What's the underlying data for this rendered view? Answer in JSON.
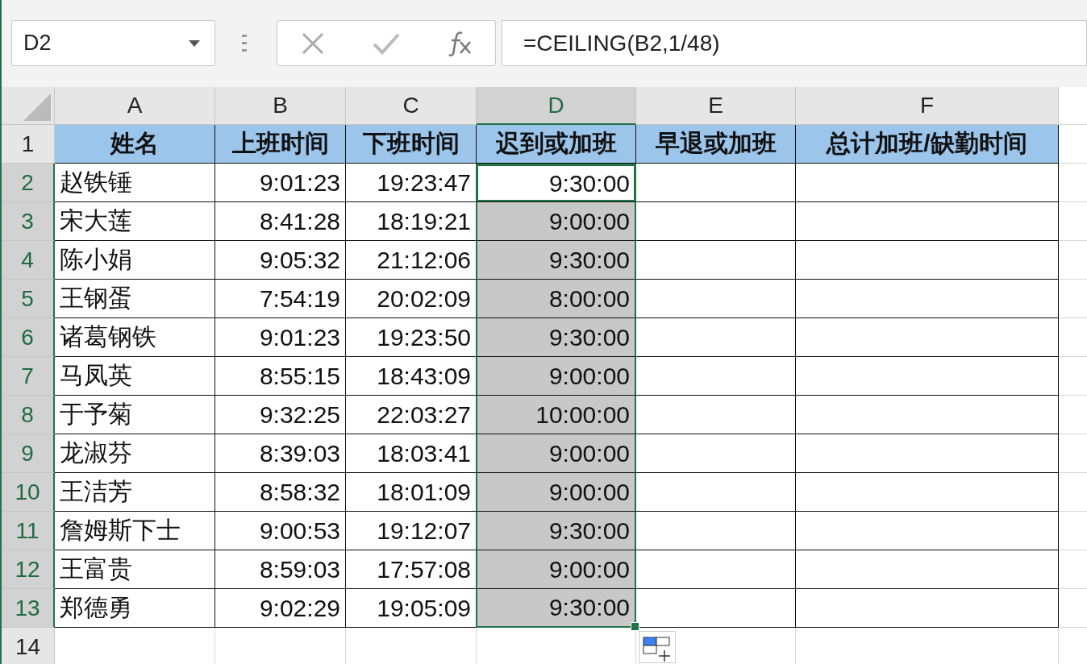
{
  "name_box": {
    "value": "D2"
  },
  "formula_bar": {
    "value": "=CEILING(B2,1/48)"
  },
  "columns": [
    {
      "label": "A",
      "selected": false
    },
    {
      "label": "B",
      "selected": false
    },
    {
      "label": "C",
      "selected": false
    },
    {
      "label": "D",
      "selected": true
    },
    {
      "label": "E",
      "selected": false
    },
    {
      "label": "F",
      "selected": false
    }
  ],
  "header_row": {
    "number": "1",
    "cells": [
      "姓名",
      "上班时间",
      "下班时间",
      "迟到或加班",
      "早退或加班",
      "总计加班/缺勤时间"
    ]
  },
  "rows": [
    {
      "number": "2",
      "selected": true,
      "active": true,
      "cells": [
        "赵铁锤",
        "9:01:23",
        "19:23:47",
        "9:30:00"
      ]
    },
    {
      "number": "3",
      "selected": true,
      "active": false,
      "cells": [
        "宋大莲",
        "8:41:28",
        "18:19:21",
        "9:00:00"
      ]
    },
    {
      "number": "4",
      "selected": true,
      "active": false,
      "cells": [
        "陈小娟",
        "9:05:32",
        "21:12:06",
        "9:30:00"
      ]
    },
    {
      "number": "5",
      "selected": true,
      "active": false,
      "cells": [
        "王钢蛋",
        "7:54:19",
        "20:02:09",
        "8:00:00"
      ]
    },
    {
      "number": "6",
      "selected": true,
      "active": false,
      "cells": [
        "诸葛钢铁",
        "9:01:23",
        "19:23:50",
        "9:30:00"
      ]
    },
    {
      "number": "7",
      "selected": true,
      "active": false,
      "cells": [
        "马凤英",
        "8:55:15",
        "18:43:09",
        "9:00:00"
      ]
    },
    {
      "number": "8",
      "selected": true,
      "active": false,
      "cells": [
        "于予菊",
        "9:32:25",
        "22:03:27",
        "10:00:00"
      ]
    },
    {
      "number": "9",
      "selected": true,
      "active": false,
      "cells": [
        "龙淑芬",
        "8:39:03",
        "18:03:41",
        "9:00:00"
      ]
    },
    {
      "number": "10",
      "selected": true,
      "active": false,
      "cells": [
        "王洁芳",
        "8:58:32",
        "18:01:09",
        "9:00:00"
      ]
    },
    {
      "number": "11",
      "selected": true,
      "active": false,
      "cells": [
        "詹姆斯下士",
        "9:00:53",
        "19:12:07",
        "9:30:00"
      ]
    },
    {
      "number": "12",
      "selected": true,
      "active": false,
      "cells": [
        "王富贵",
        "8:59:03",
        "17:57:08",
        "9:00:00"
      ]
    },
    {
      "number": "13",
      "selected": true,
      "active": false,
      "cells": [
        "郑德勇",
        "9:02:29",
        "19:05:09",
        "9:30:00"
      ]
    },
    {
      "number": "14",
      "selected": false,
      "active": false,
      "cells": []
    }
  ]
}
